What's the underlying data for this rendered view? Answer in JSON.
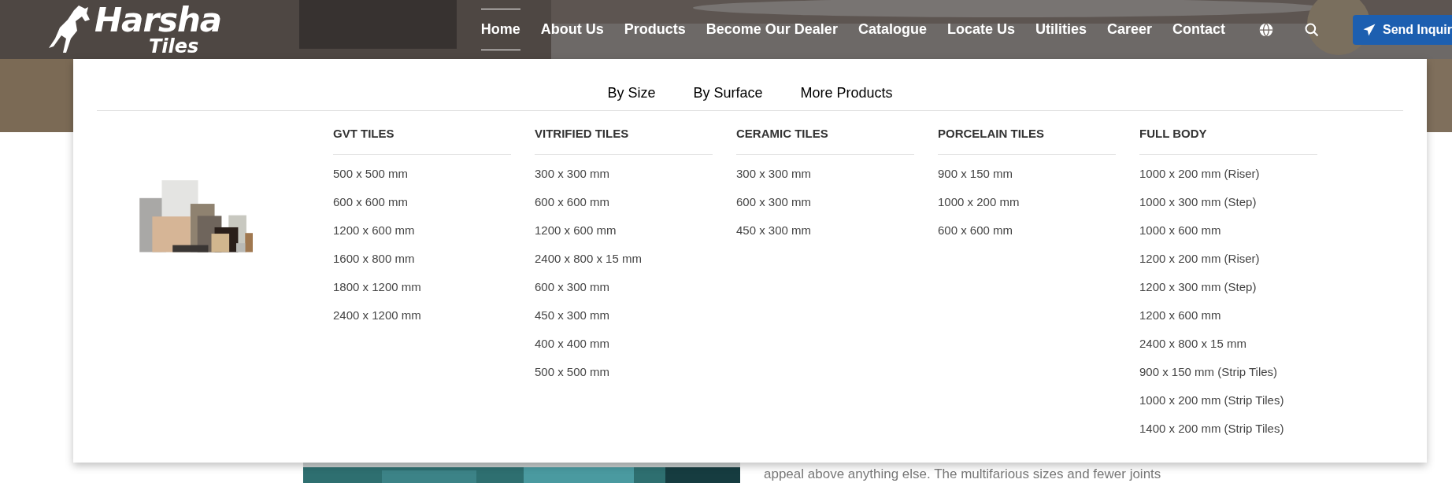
{
  "header": {
    "logo": {
      "name": "Harsha",
      "sub": "Tiles"
    },
    "nav": [
      {
        "label": "Home",
        "selected": true
      },
      {
        "label": "About Us",
        "selected": false
      },
      {
        "label": "Products",
        "selected": false
      },
      {
        "label": "Become Our Dealer",
        "selected": false
      },
      {
        "label": "Catalogue",
        "selected": false
      },
      {
        "label": "Locate Us",
        "selected": false
      },
      {
        "label": "Utilities",
        "selected": false
      },
      {
        "label": "Career",
        "selected": false
      },
      {
        "label": "Contact",
        "selected": false
      }
    ],
    "inquiry_button": "Send Inquir"
  },
  "mega_menu": {
    "tabs": [
      {
        "label": "By Size",
        "selected": false
      },
      {
        "label": "By Surface",
        "selected": false
      },
      {
        "label": "More Products",
        "selected": false
      }
    ],
    "columns": [
      {
        "title": "GVT TILES",
        "items": [
          "500 x 500 mm",
          "600 x 600 mm",
          "1200 x 600 mm",
          "1600 x 800 mm",
          "1800 x 1200 mm",
          "2400 x 1200 mm"
        ]
      },
      {
        "title": "VITRIFIED TILES",
        "items": [
          "300 x 300 mm",
          "600 x 600 mm",
          "1200 x 600 mm",
          "2400 x 800 x 15 mm",
          "600 x 300 mm",
          "450 x 300 mm",
          "400 x 400 mm",
          "500 x 500 mm"
        ]
      },
      {
        "title": "CERAMIC TILES",
        "items": [
          "300 x 300 mm",
          "600 x 300 mm",
          "450 x 300 mm"
        ]
      },
      {
        "title": "PORCELAIN TILES",
        "items": [
          "900 x 150 mm",
          "1000 x 200 mm",
          "600 x 600 mm"
        ]
      },
      {
        "title": "FULL BODY",
        "items": [
          "1000 x 200 mm (Riser)",
          "1000 x 300 mm (Step)",
          "1000 x 600 mm",
          "1200 x 200 mm (Riser)",
          "1200 x 300 mm (Step)",
          "1200 x 600 mm",
          "2400 x 800 x 15 mm",
          "900 x 150 mm (Strip Tiles)",
          "1000 x 200 mm (Strip Tiles)",
          "1400 x 200 mm (Strip Tiles)"
        ]
      }
    ]
  },
  "body": {
    "paragraph_lines": [
      "appeal above anything else. The multifarious sizes and fewer joints"
    ]
  }
}
